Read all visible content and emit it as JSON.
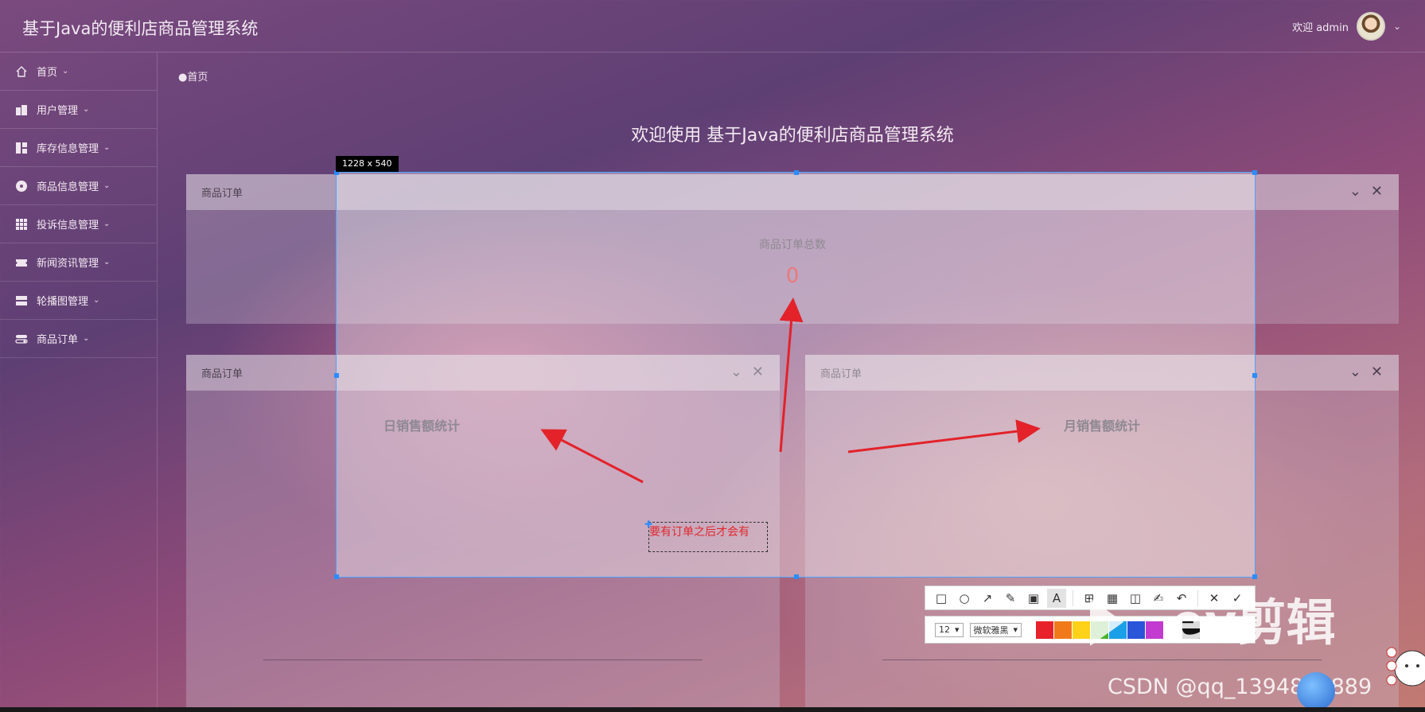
{
  "header": {
    "app_title": "基于Java的便利店商品管理系统",
    "welcome_text": "欢迎 admin"
  },
  "sidebar": {
    "items": [
      {
        "label": "首页",
        "icon": "home-icon"
      },
      {
        "label": "用户管理",
        "icon": "building-icon"
      },
      {
        "label": "库存信息管理",
        "icon": "layout-icon"
      },
      {
        "label": "商品信息管理",
        "icon": "disc-icon"
      },
      {
        "label": "投诉信息管理",
        "icon": "grid-icon"
      },
      {
        "label": "新闻资讯管理",
        "icon": "ticket-icon"
      },
      {
        "label": "轮播图管理",
        "icon": "server-icon"
      },
      {
        "label": "商品订单",
        "icon": "toggle-icon"
      }
    ]
  },
  "breadcrumb": {
    "label": "首页"
  },
  "main": {
    "welcome_title": "欢迎使用 基于Java的便利店商品管理系统",
    "top_panel": {
      "header": "商品订单",
      "stat_label": "商品订单总数",
      "stat_value": "0"
    },
    "left_panel": {
      "header": "商品订单",
      "chart_title": "日销售额统计"
    },
    "right_panel": {
      "header": "商品订单",
      "chart_title": "月销售额统计"
    }
  },
  "screenshot_tool": {
    "size_label": "1228 x 540",
    "annotation_text": "要有订单之后才会有",
    "font_size": "12",
    "font_name": "微软雅黑",
    "colors": [
      "#e8222a",
      "#f07a1a",
      "#ffd21a",
      "#4caf28",
      "#1aa0e8",
      "#2a55d8",
      "#c23ad0",
      "#ffffff",
      "#111111"
    ]
  },
  "watermark": {
    "csdn_text": "CSDN @qq_1394842889",
    "logo_text": "ev剪辑"
  }
}
